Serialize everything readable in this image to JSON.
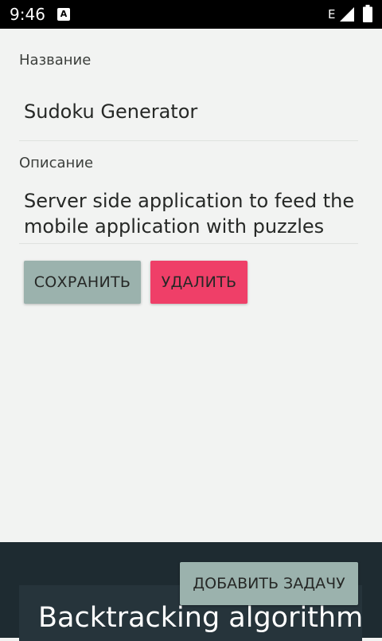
{
  "status_bar": {
    "time": "9:46",
    "notification_icon": "A",
    "network": "E",
    "signal_icon": "signal-icon",
    "battery_icon": "battery-icon"
  },
  "form": {
    "name_label": "Название",
    "name_value": "Sudoku Generator",
    "description_label": "Описание",
    "description_line1": "Server side application to feed the",
    "description_line2": "mobile application with puzzles",
    "save_label": "СОХРАНИТЬ",
    "delete_label": "УДАЛИТЬ"
  },
  "tasks": {
    "add_task_label": "ДОБАВИТЬ ЗАДАЧУ",
    "items": [
      {
        "title": "Backtracking algorithm"
      }
    ]
  },
  "colors": {
    "background": "#f2f3f2",
    "save_button": "#9bb2ad",
    "delete_button": "#ef3f68",
    "bottom_panel": "#1e2b31"
  }
}
